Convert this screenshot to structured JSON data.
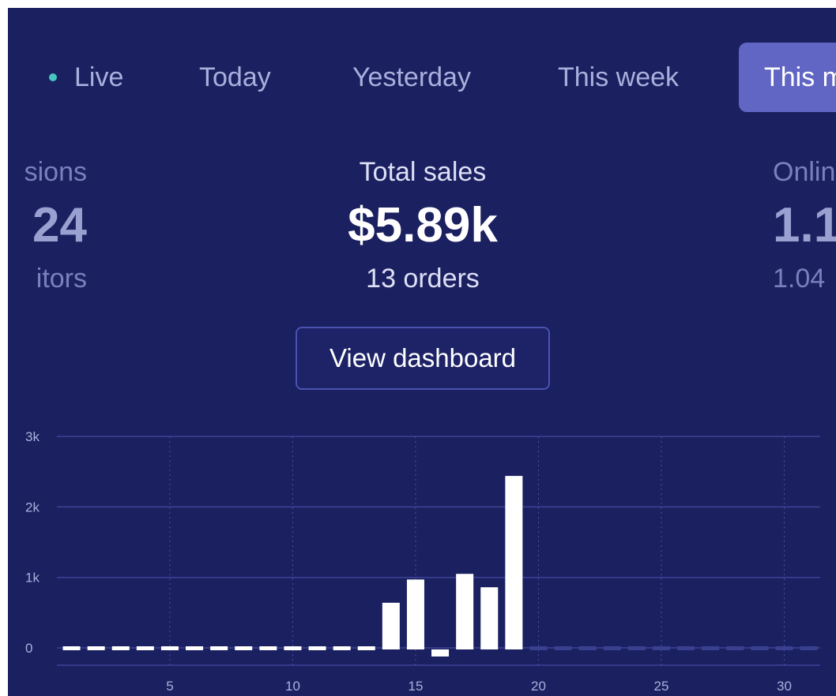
{
  "tabs": [
    {
      "label": "Live",
      "active": false
    },
    {
      "label": "Today",
      "active": false
    },
    {
      "label": "Yesterday",
      "active": false
    },
    {
      "label": "This week",
      "active": false
    },
    {
      "label": "This m",
      "active": true
    }
  ],
  "metrics": {
    "left": {
      "label": "sions",
      "value": "24",
      "sub": "itors"
    },
    "center": {
      "label": "Total sales",
      "value": "$5.89k",
      "sub": "13 orders"
    },
    "right": {
      "label": "Onlin",
      "value": "1.1",
      "sub": "1.04"
    }
  },
  "actions": {
    "view_dashboard": "View dashboard"
  },
  "colors": {
    "background": "#1b2060",
    "active_tab": "#6166c4",
    "live_dot": "#46c6c0",
    "bar": "#ffffff",
    "grid": "#3d4396"
  },
  "chart_data": {
    "type": "bar",
    "x": [
      1,
      2,
      3,
      4,
      5,
      6,
      7,
      8,
      9,
      10,
      11,
      12,
      13,
      14,
      15,
      16,
      17,
      18,
      19,
      20,
      21,
      22,
      23,
      24,
      25,
      26,
      27,
      28,
      29,
      30,
      31
    ],
    "values": [
      0,
      0,
      0,
      0,
      0,
      0,
      0,
      0,
      0,
      0,
      0,
      0,
      0,
      640,
      970,
      -100,
      1050,
      860,
      2440,
      0,
      0,
      0,
      0,
      0,
      0,
      0,
      0,
      0,
      0,
      0,
      0
    ],
    "future_from_day": 20,
    "xticks": [
      5,
      10,
      15,
      20,
      25,
      30
    ],
    "yticks": [
      0,
      1000,
      2000,
      3000
    ],
    "ytick_labels": [
      "0",
      "1k",
      "2k",
      "3k"
    ],
    "ylim": [
      -200,
      3000
    ],
    "grid": true
  }
}
